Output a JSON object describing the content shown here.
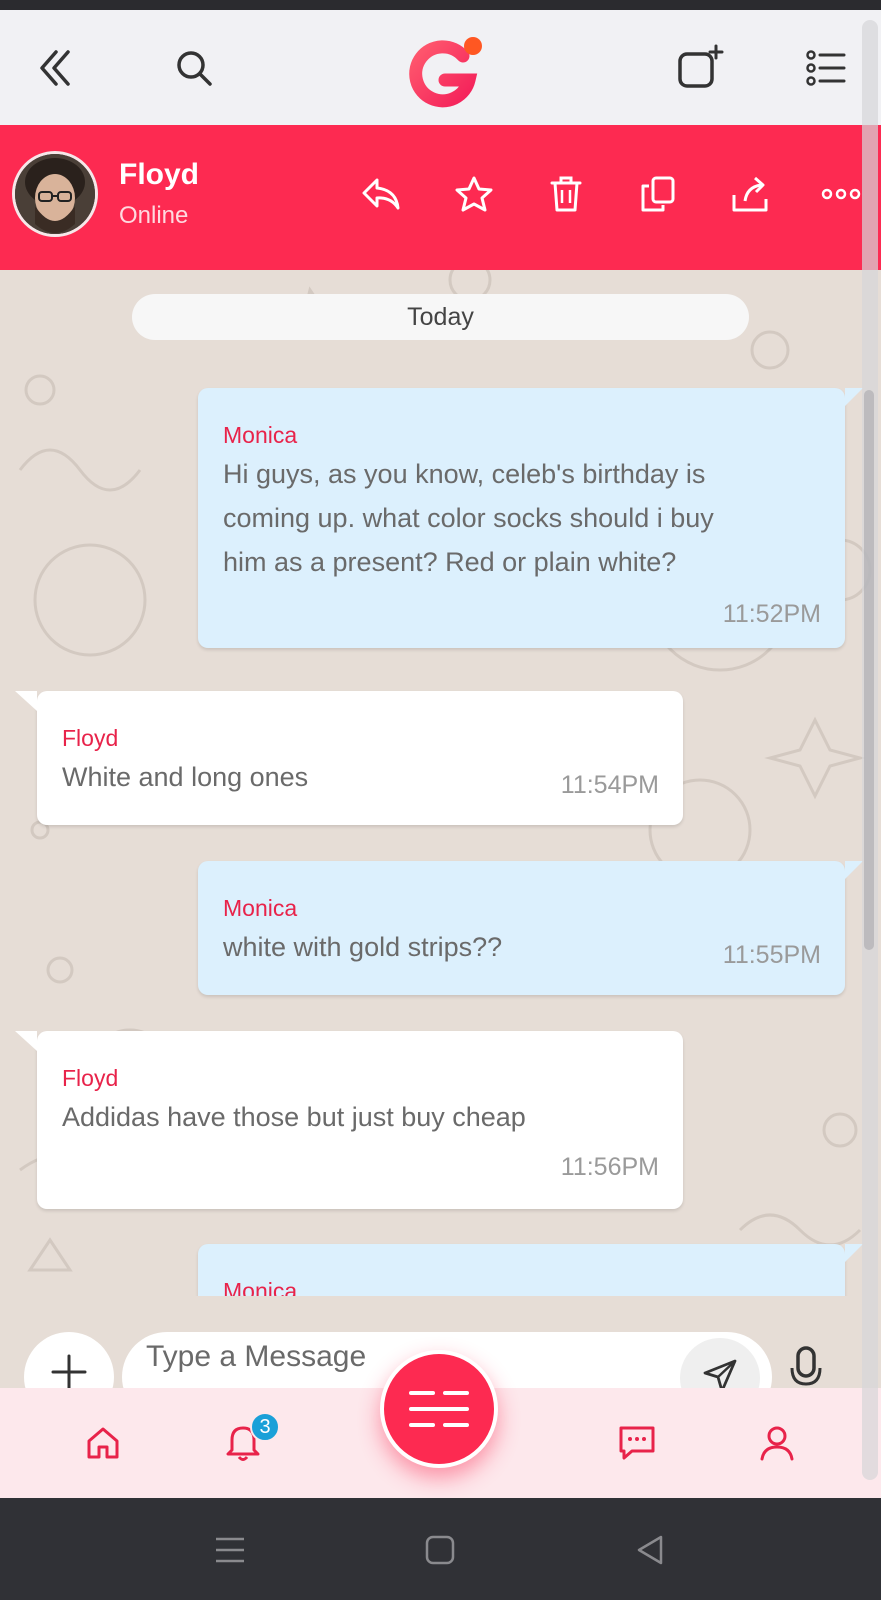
{
  "colors": {
    "brand": "#fd2a51",
    "outgoing_bubble": "#dcf0fd",
    "incoming_bubble": "#ffffff",
    "sender_name": "#e8234a",
    "badge": "#1aa0d8"
  },
  "topbar": {
    "icons": [
      "double-chevron-left-icon",
      "search-icon",
      "app-logo",
      "new-chat-icon",
      "list-menu-icon"
    ]
  },
  "chat_header": {
    "contact_name": "Floyd",
    "contact_status": "Online",
    "actions": [
      "reply-icon",
      "star-icon",
      "trash-icon",
      "copy-icon",
      "share-icon",
      "more-icon"
    ]
  },
  "chat": {
    "date_divider": "Today",
    "messages": [
      {
        "direction": "out",
        "sender": "Monica",
        "lines": [
          "Hi guys, as you know, celeb's birthday is",
          "coming up. what color socks should i buy",
          "him as a present? Red or plain white?"
        ],
        "time": "11:52PM"
      },
      {
        "direction": "in",
        "sender": "Floyd",
        "lines": [
          "White and long ones"
        ],
        "time": "11:54PM"
      },
      {
        "direction": "out",
        "sender": "Monica",
        "lines": [
          "white with gold strips??"
        ],
        "time": "11:55PM"
      },
      {
        "direction": "in",
        "sender": "Floyd",
        "lines": [
          "Addidas have those but just buy cheap"
        ],
        "time": "11:56PM"
      },
      {
        "direction": "out",
        "sender": "Monica",
        "lines": [],
        "time": ""
      }
    ]
  },
  "composer": {
    "placeholder": "Type a Message"
  },
  "bottom_nav": {
    "items": [
      "home-icon",
      "notifications-icon",
      "menu-fab",
      "messages-icon",
      "profile-icon"
    ],
    "notification_count": "3"
  },
  "system_nav": {
    "items": [
      "recent-apps-icon",
      "home-square-icon",
      "back-triangle-icon"
    ]
  }
}
